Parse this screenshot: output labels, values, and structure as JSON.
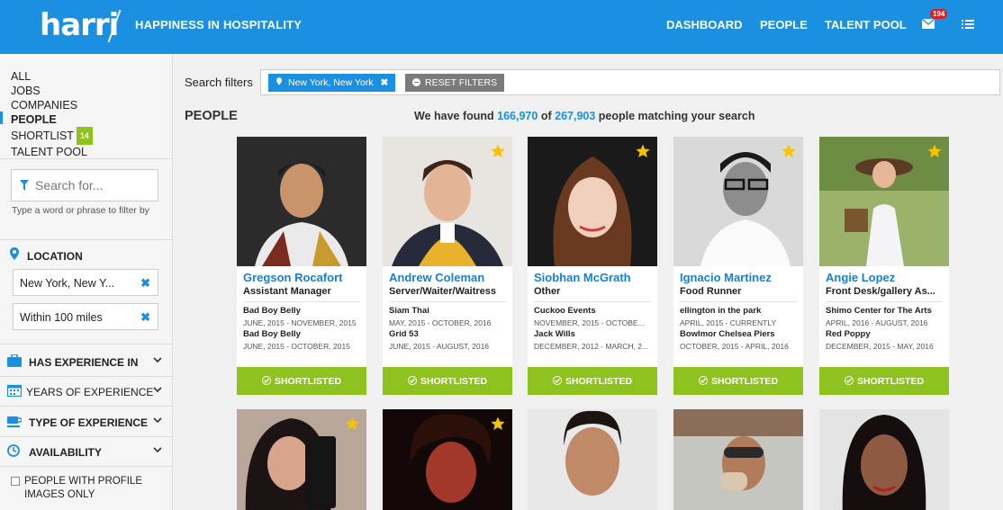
{
  "header": {
    "logo": "harri",
    "tagline": "HAPPINESS IN HOSPITALITY",
    "nav": [
      "DASHBOARD",
      "PEOPLE",
      "TALENT POOL"
    ],
    "messages_count": "194"
  },
  "sidebar": {
    "nav": [
      "ALL",
      "JOBS",
      "COMPANIES",
      "PEOPLE",
      "SHORTLIST",
      "TALENT POOL"
    ],
    "shortlist_count": "14",
    "search_placeholder": "Search for...",
    "search_hint": "Type a word or phrase to filter by",
    "location_title": "LOCATION",
    "location_value": "New York, New Y...",
    "radius_value": "Within 100 miles",
    "filters": [
      "HAS EXPERIENCE IN",
      "YEARS OF EXPERIENCE",
      "TYPE OF EXPERIENCE",
      "AVAILABILITY"
    ],
    "profile_images_label": "PEOPLE WITH PROFILE IMAGES ONLY"
  },
  "main": {
    "search_filters_label": "Search filters",
    "active_filter": "New York, New York",
    "reset_label": "RESET FILTERS",
    "people_title": "PEOPLE",
    "results_prefix": "We have found",
    "results_found": "166,970",
    "results_of": "of",
    "results_total": "267,903",
    "results_suffix": "people matching your search",
    "shortlisted_label": "SHORTLISTED"
  },
  "cards": [
    {
      "name": "Gregson Rocafort",
      "role": "Assistant Manager",
      "starred": false,
      "exp": [
        {
          "company": "Bad Boy Belly",
          "dates": "JUNE, 2015 - NOVEMBER, 2015"
        },
        {
          "company": "Bad Boy Belly",
          "dates": "JUNE, 2015 - OCTOBER, 2015"
        }
      ]
    },
    {
      "name": "Andrew Coleman",
      "role": "Server/Waiter/Waitress",
      "starred": true,
      "exp": [
        {
          "company": "Siam Thai",
          "dates": "MAY, 2015 - OCTOBER, 2016"
        },
        {
          "company": "Grid 53",
          "dates": "JUNE, 2015 - AUGUST, 2016"
        }
      ]
    },
    {
      "name": "Siobhan McGrath",
      "role": "Other",
      "starred": true,
      "exp": [
        {
          "company": "Cuckoo Events",
          "dates": "NOVEMBER, 2015 - OCTOBE..."
        },
        {
          "company": "Jack Wills",
          "dates": "DECEMBER, 2012 - MARCH, 2..."
        }
      ]
    },
    {
      "name": "Ignacio Martinez",
      "role": "Food Runner",
      "starred": true,
      "exp": [
        {
          "company": "ellington in the park",
          "dates": "APRIL, 2015 - CURRENTLY"
        },
        {
          "company": "Bowlmor Chelsea Piers",
          "dates": "OCTOBER, 2015 - APRIL, 2016"
        }
      ]
    },
    {
      "name": "Angie Lopez",
      "role": "Front Desk/gallery As...",
      "starred": true,
      "exp": [
        {
          "company": "Shimo Center for The Arts",
          "dates": "APRIL, 2016 - AUGUST, 2016"
        },
        {
          "company": "Red Poppy",
          "dates": "DECEMBER, 2015 - MAY, 2016"
        }
      ]
    }
  ],
  "row2_starred": [
    true,
    true,
    false,
    false,
    false
  ],
  "colors": {
    "brand": "#1b8fe0",
    "accent": "#8dc21f",
    "badge": "#e02020"
  }
}
